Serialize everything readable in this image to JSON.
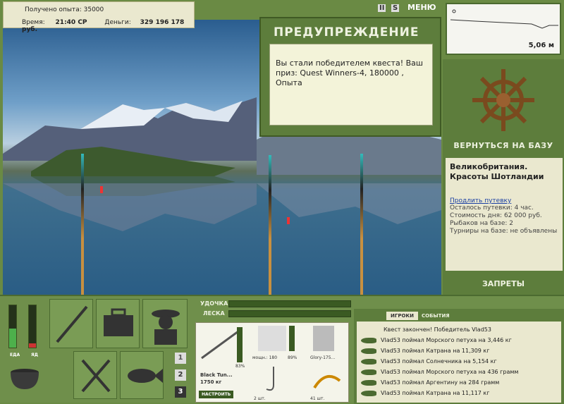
{
  "hud": {
    "xp_label": "Получено опыта:",
    "xp_value": "35000",
    "time_label": "Время:",
    "time_value": "21:40 СР",
    "money_label": "Деньги:",
    "money_value": "329 196 178 руб."
  },
  "top_buttons": {
    "pause": "II",
    "sound": "S",
    "menu": "МЕНЮ"
  },
  "depth": {
    "value": "5,06 м"
  },
  "warning": {
    "title": "ПРЕДУПРЕЖДЕНИЕ",
    "message": "Вы стали победителем квеста! Ваш приз: Quest Winners-4, 180000 , Опыта"
  },
  "base": {
    "return_label": "ВЕРНУТЬСЯ НА БАЗУ",
    "title": "Великобритания. Красоты Шотландии",
    "extend_link": "Продлить путевку",
    "lines": [
      "Осталось путевки: 4 час.",
      "Стоимость дня: 62 000 руб.",
      "Рыбаков на базе: 2",
      "Турниры на базе: не объявлены"
    ],
    "bans_label": "ЗАПРЕТЫ"
  },
  "meters": {
    "food_label": "ЕДА",
    "poison_label": "ЯД",
    "food_level": 0.45,
    "poison_level": 0.1
  },
  "tackle": {
    "rod_label": "УДОЧКА",
    "line_label": "ЛЕСКА"
  },
  "inventory": {
    "rod_name": "Black Tun...",
    "rod_weight": "1750 кг",
    "rod_percent": "83%",
    "setup_button": "НАСТРОИТЬ",
    "reel_power": "мощн.: 180",
    "reel_percent": "89%",
    "line_name": "Glory-175...",
    "hook_count": "2 шт.",
    "bait_count": "41 шт."
  },
  "slots": {
    "one": "1",
    "two": "2",
    "three": "3"
  },
  "events": {
    "tab_players": "ИГРОКИ",
    "tab_events": "СОБЫТИЯ",
    "items": [
      "Квест закончен! Победитель Vlad53",
      "Vlad53 поймал Морского петуха на 3,446 кг",
      "Vlad53 поймал Катрана на 11,309 кг",
      "Vlad53 поймал Солнечника на 5,154 кг",
      "Vlad53 поймал Морского петуха на 436 грамм",
      "Vlad53 поймал Аргентину на 284 грамм",
      "Vlad53 поймал Катрана на 11,117 кг"
    ]
  }
}
